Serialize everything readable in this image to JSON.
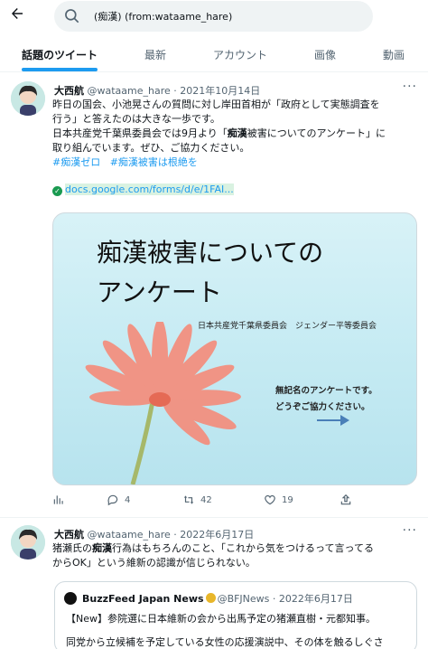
{
  "search": {
    "query": "(痴漢) (from:wataame_hare)"
  },
  "tabs": [
    {
      "label": "話題のツイート"
    },
    {
      "label": "最新"
    },
    {
      "label": "アカウント"
    },
    {
      "label": "画像"
    },
    {
      "label": "動画"
    }
  ],
  "accent_color": "#1d9bf0",
  "tweets": [
    {
      "name": "大西航",
      "handle": "@wataame_hare",
      "date": "· 2021年10月14日",
      "line1": "昨日の国会、小池晃さんの質問に対し岸田首相が「政府として実態調査を",
      "line2": "行う」と答えたのは大きな一歩です。",
      "line3a": "日本共産党千葉県委員会では9月より「",
      "line3b": "痴漢",
      "line3c": "被害についてのアンケート」に",
      "line4": "取り組んでいます。ぜひ、ご協力ください。",
      "hashtag1": "#痴漢ゼロ",
      "hashtag2": "#痴漢被害は根絶を",
      "link": "docs.google.com/forms/d/e/1FAI...",
      "image": {
        "title_line1": "痴漢被害についての",
        "title_line2": "アンケート",
        "org": "日本共産党千葉県委員会　ジェンダー平等委員会",
        "note1": "無記名のアンケートです。",
        "note2": "どうぞご協力ください。"
      },
      "replies": "4",
      "retweets": "42",
      "likes": "19"
    },
    {
      "name": "大西航",
      "handle": "@wataame_hare",
      "date": "· 2022年6月17日",
      "line1a": "猪瀬氏の",
      "line1b": "痴漢",
      "line1c": "行為はもちろんのこと、「これから気をつけるって言ってる",
      "line2": "からOK」という維新の認識が信じられない。",
      "quote": {
        "name": "BuzzFeed Japan News",
        "handle": "@BFJNews · 2022年6月17日",
        "line1": "【New】参院選に日本維新の会から出馬予定の猪瀬直樹・元都知事。",
        "line2": "同党から立候補を予定している女性の応援演説中、その体を触るしぐさ"
      }
    }
  ]
}
